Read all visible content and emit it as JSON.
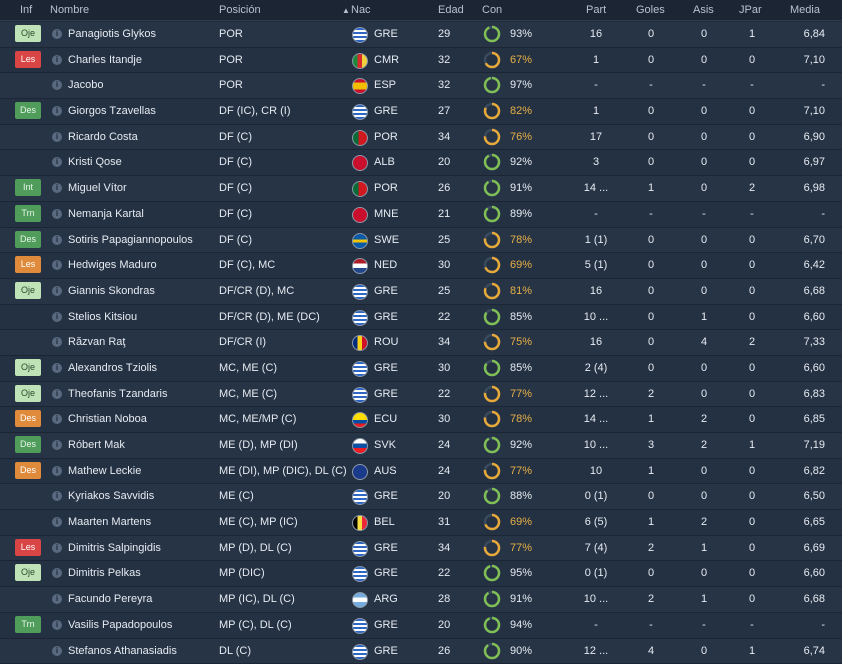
{
  "headers": [
    "Inf",
    "Nombre",
    "Posición",
    "▲",
    "Nac",
    "Edad",
    "Con",
    "Part",
    "Goles",
    "Asis",
    "JPar",
    "Media"
  ],
  "players": [
    {
      "inf": "Oje",
      "inf_color": "#bfe3b6",
      "inf_text_color": "#2b4a2f",
      "name": "Panagiotis Glykos",
      "pos": "POR",
      "flag": "gre",
      "nac": "GRE",
      "age": "29",
      "con": "93%",
      "con_level": 93,
      "con_color": "green",
      "part": "16",
      "goles": "0",
      "asis": "0",
      "jpar": "1",
      "media": "6,84"
    },
    {
      "inf": "Les",
      "inf_color": "#d94545",
      "inf_text_color": "#ffffff",
      "name": "Charles Itandje",
      "pos": "POR",
      "flag": "cmr",
      "nac": "CMR",
      "age": "32",
      "con": "67%",
      "con_level": 67,
      "con_color": "yellow",
      "part": "1",
      "goles": "0",
      "asis": "0",
      "jpar": "0",
      "media": "7,10"
    },
    {
      "inf": "",
      "inf_color": "",
      "inf_text_color": "",
      "name": "Jacobo",
      "pos": "POR",
      "flag": "esp",
      "nac": "ESP",
      "age": "32",
      "con": "97%",
      "con_level": 97,
      "con_color": "green",
      "part": "-",
      "goles": "-",
      "asis": "-",
      "jpar": "-",
      "media": "-"
    },
    {
      "inf": "Des",
      "inf_color": "#4f9c5b",
      "inf_text_color": "#e8f6ea",
      "name": "Giorgos Tzavellas",
      "pos": "DF (IC), CR (I)",
      "flag": "gre",
      "nac": "GRE",
      "age": "27",
      "con": "82%",
      "con_level": 82,
      "con_color": "yellow",
      "part": "1",
      "goles": "0",
      "asis": "0",
      "jpar": "0",
      "media": "7,10"
    },
    {
      "inf": "",
      "inf_color": "",
      "inf_text_color": "",
      "name": "Ricardo Costa",
      "pos": "DF (C)",
      "flag": "por",
      "nac": "POR",
      "age": "34",
      "con": "76%",
      "con_level": 76,
      "con_color": "yellow",
      "part": "17",
      "goles": "0",
      "asis": "0",
      "jpar": "0",
      "media": "6,90"
    },
    {
      "inf": "",
      "inf_color": "",
      "inf_text_color": "",
      "name": "Kristi Qose",
      "pos": "DF (C)",
      "flag": "alb",
      "nac": "ALB",
      "age": "20",
      "con": "92%",
      "con_level": 92,
      "con_color": "green",
      "part": "3",
      "goles": "0",
      "asis": "0",
      "jpar": "0",
      "media": "6,97"
    },
    {
      "inf": "Int",
      "inf_color": "#4f9c5b",
      "inf_text_color": "#e8f6ea",
      "name": "Miguel Vítor",
      "pos": "DF (C)",
      "flag": "por",
      "nac": "POR",
      "age": "26",
      "con": "91%",
      "con_level": 91,
      "con_color": "green",
      "part": "14 ...",
      "goles": "1",
      "asis": "0",
      "jpar": "2",
      "media": "6,98"
    },
    {
      "inf": "Trn",
      "inf_color": "#4f9c5b",
      "inf_text_color": "#e8f6ea",
      "name": "Nemanja Kartal",
      "pos": "DF (C)",
      "flag": "mne",
      "nac": "MNE",
      "age": "21",
      "con": "89%",
      "con_level": 89,
      "con_color": "green",
      "part": "-",
      "goles": "-",
      "asis": "-",
      "jpar": "-",
      "media": "-"
    },
    {
      "inf": "Des",
      "inf_color": "#4f9c5b",
      "inf_text_color": "#e8f6ea",
      "name": "Sotiris Papagiannopoulos",
      "pos": "DF (C)",
      "flag": "swe",
      "nac": "SWE",
      "age": "25",
      "con": "78%",
      "con_level": 78,
      "con_color": "yellow",
      "part": "1 (1)",
      "goles": "0",
      "asis": "0",
      "jpar": "0",
      "media": "6,70"
    },
    {
      "inf": "Les",
      "inf_color": "#e08a3c",
      "inf_text_color": "#ffffff",
      "name": "Hedwiges Maduro",
      "pos": "DF (C), MC",
      "flag": "ned",
      "nac": "NED",
      "age": "30",
      "con": "69%",
      "con_level": 69,
      "con_color": "yellow",
      "part": "5 (1)",
      "goles": "0",
      "asis": "0",
      "jpar": "0",
      "media": "6,42"
    },
    {
      "inf": "Oje",
      "inf_color": "#bfe3b6",
      "inf_text_color": "#2b4a2f",
      "name": "Giannis Skondras",
      "pos": "DF/CR (D), MC",
      "flag": "gre",
      "nac": "GRE",
      "age": "25",
      "con": "81%",
      "con_level": 81,
      "con_color": "yellow",
      "part": "16",
      "goles": "0",
      "asis": "0",
      "jpar": "0",
      "media": "6,68"
    },
    {
      "inf": "",
      "inf_color": "",
      "inf_text_color": "",
      "name": "Stelios Kitsiou",
      "pos": "DF/CR (D), ME (DC)",
      "flag": "gre",
      "nac": "GRE",
      "age": "22",
      "con": "85%",
      "con_level": 85,
      "con_color": "green",
      "part": "10 ...",
      "goles": "0",
      "asis": "1",
      "jpar": "0",
      "media": "6,60"
    },
    {
      "inf": "",
      "inf_color": "",
      "inf_text_color": "",
      "name": "Răzvan Raţ",
      "pos": "DF/CR (I)",
      "flag": "rou",
      "nac": "ROU",
      "age": "34",
      "con": "75%",
      "con_level": 75,
      "con_color": "yellow",
      "part": "16",
      "goles": "0",
      "asis": "4",
      "jpar": "2",
      "media": "7,33"
    },
    {
      "inf": "Oje",
      "inf_color": "#bfe3b6",
      "inf_text_color": "#2b4a2f",
      "name": "Alexandros Tziolis",
      "pos": "MC, ME (C)",
      "flag": "gre",
      "nac": "GRE",
      "age": "30",
      "con": "85%",
      "con_level": 85,
      "con_color": "green",
      "part": "2 (4)",
      "goles": "0",
      "asis": "0",
      "jpar": "0",
      "media": "6,60"
    },
    {
      "inf": "Oje",
      "inf_color": "#bfe3b6",
      "inf_text_color": "#2b4a2f",
      "name": "Theofanis Tzandaris",
      "pos": "MC, ME (C)",
      "flag": "gre",
      "nac": "GRE",
      "age": "22",
      "con": "77%",
      "con_level": 77,
      "con_color": "yellow",
      "part": "12 ...",
      "goles": "2",
      "asis": "0",
      "jpar": "0",
      "media": "6,83"
    },
    {
      "inf": "Des",
      "inf_color": "#e08a3c",
      "inf_text_color": "#ffffff",
      "name": "Christian Noboa",
      "pos": "MC, ME/MP (C)",
      "flag": "ecu",
      "nac": "ECU",
      "age": "30",
      "con": "78%",
      "con_level": 78,
      "con_color": "yellow",
      "part": "14 ...",
      "goles": "1",
      "asis": "2",
      "jpar": "0",
      "media": "6,85"
    },
    {
      "inf": "Des",
      "inf_color": "#4f9c5b",
      "inf_text_color": "#e8f6ea",
      "name": "Róbert Mak",
      "pos": "ME (D), MP (DI)",
      "flag": "svk",
      "nac": "SVK",
      "age": "24",
      "con": "92%",
      "con_level": 92,
      "con_color": "green",
      "part": "10 ...",
      "goles": "3",
      "asis": "2",
      "jpar": "1",
      "media": "7,19"
    },
    {
      "inf": "Des",
      "inf_color": "#e08a3c",
      "inf_text_color": "#ffffff",
      "name": "Mathew Leckie",
      "pos": "ME (DI), MP (DIC), DL (C)",
      "flag": "aus",
      "nac": "AUS",
      "age": "24",
      "con": "77%",
      "con_level": 77,
      "con_color": "yellow",
      "part": "10",
      "goles": "1",
      "asis": "0",
      "jpar": "0",
      "media": "6,82"
    },
    {
      "inf": "",
      "inf_color": "",
      "inf_text_color": "",
      "name": "Kyriakos Savvidis",
      "pos": "ME (C)",
      "flag": "gre",
      "nac": "GRE",
      "age": "20",
      "con": "88%",
      "con_level": 88,
      "con_color": "green",
      "part": "0 (1)",
      "goles": "0",
      "asis": "0",
      "jpar": "0",
      "media": "6,50"
    },
    {
      "inf": "",
      "inf_color": "",
      "inf_text_color": "",
      "name": "Maarten Martens",
      "pos": "ME (C), MP (IC)",
      "flag": "bel",
      "nac": "BEL",
      "age": "31",
      "con": "69%",
      "con_level": 69,
      "con_color": "yellow",
      "part": "6 (5)",
      "goles": "1",
      "asis": "2",
      "jpar": "0",
      "media": "6,65"
    },
    {
      "inf": "Les",
      "inf_color": "#d94545",
      "inf_text_color": "#ffffff",
      "name": "Dimitris Salpingidis",
      "pos": "MP (D), DL (C)",
      "flag": "gre",
      "nac": "GRE",
      "age": "34",
      "con": "77%",
      "con_level": 77,
      "con_color": "yellow",
      "part": "7 (4)",
      "goles": "2",
      "asis": "1",
      "jpar": "0",
      "media": "6,69"
    },
    {
      "inf": "Oje",
      "inf_color": "#bfe3b6",
      "inf_text_color": "#2b4a2f",
      "name": "Dimitris Pelkas",
      "pos": "MP (DIC)",
      "flag": "gre",
      "nac": "GRE",
      "age": "22",
      "con": "95%",
      "con_level": 95,
      "con_color": "green",
      "part": "0 (1)",
      "goles": "0",
      "asis": "0",
      "jpar": "0",
      "media": "6,60"
    },
    {
      "inf": "",
      "inf_color": "",
      "inf_text_color": "",
      "name": "Facundo Pereyra",
      "pos": "MP (IC), DL (C)",
      "flag": "arg",
      "nac": "ARG",
      "age": "28",
      "con": "91%",
      "con_level": 91,
      "con_color": "green",
      "part": "10 ...",
      "goles": "2",
      "asis": "1",
      "jpar": "0",
      "media": "6,68"
    },
    {
      "inf": "Trn",
      "inf_color": "#4f9c5b",
      "inf_text_color": "#e8f6ea",
      "name": "Vasilis Papadopoulos",
      "pos": "MP (C), DL (C)",
      "flag": "gre",
      "nac": "GRE",
      "age": "20",
      "con": "94%",
      "con_level": 94,
      "con_color": "green",
      "part": "-",
      "goles": "-",
      "asis": "-",
      "jpar": "-",
      "media": "-"
    },
    {
      "inf": "",
      "inf_color": "",
      "inf_text_color": "",
      "name": "Stefanos Athanasiadis",
      "pos": "DL (C)",
      "flag": "gre",
      "nac": "GRE",
      "age": "26",
      "con": "90%",
      "con_level": 90,
      "con_color": "green",
      "part": "12 ...",
      "goles": "4",
      "asis": "0",
      "jpar": "1",
      "media": "6,74"
    }
  ]
}
